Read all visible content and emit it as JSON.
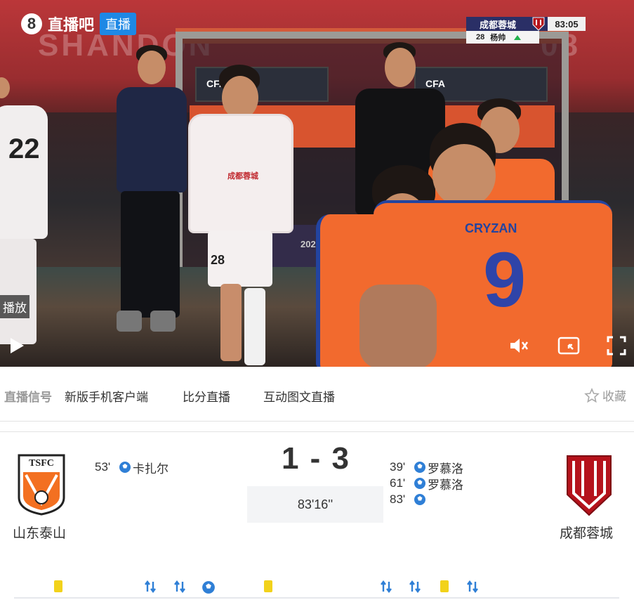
{
  "player": {
    "brand_name": "直播吧",
    "live_badge": "直播",
    "background_text_left": "SHANDON",
    "background_text_right": "08",
    "board_text": "CFA",
    "banner_text": "2025",
    "scorebug": {
      "team": "成都蓉城",
      "time": "83:05",
      "sub_number": "28",
      "sub_player": "杨帅"
    },
    "jersey_numbers": [
      "22",
      "9",
      "28"
    ],
    "jersey_name": "CRYZAN",
    "play_tooltip": "播放",
    "controls": [
      "play-icon",
      "volume-icon",
      "pip-icon",
      "fullscreen-icon"
    ]
  },
  "signal_bar": {
    "label": "直播信号",
    "links": [
      "新版手机客户端",
      "比分直播",
      "互动图文直播"
    ],
    "favorite": "收藏"
  },
  "match": {
    "home": {
      "name": "山东泰山",
      "crest_text": "TSFC",
      "goals": [
        {
          "minute": "53'",
          "player": "卡扎尔"
        }
      ]
    },
    "away": {
      "name": "成都蓉城",
      "goals": [
        {
          "minute": "39'",
          "player": "罗慕洛"
        },
        {
          "minute": "61'",
          "player": "罗慕洛"
        },
        {
          "minute": "83'",
          "player": ""
        }
      ]
    },
    "score": "1 - 3",
    "clock": "83'16''"
  },
  "timeline": {
    "events": [
      "yellow-card",
      "substitution",
      "substitution",
      "goal",
      "yellow-card",
      "substitution",
      "substitution",
      "yellow-card",
      "substitution"
    ]
  },
  "colors": {
    "live_blue": "#1e88e5",
    "scorebug_navy": "#2a2f66",
    "yellow_card": "#f2d21b",
    "goal_blue": "#2f7fd6",
    "away_red": "#b5121b"
  }
}
